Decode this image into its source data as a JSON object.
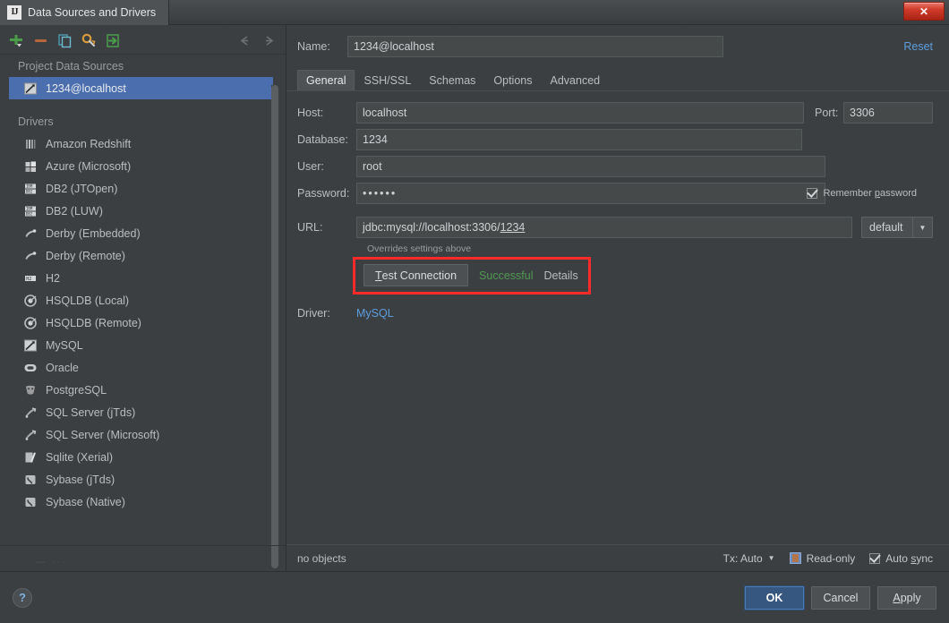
{
  "window": {
    "title": "Data Sources and Drivers",
    "app_icon": "IJ",
    "close_label": "✕"
  },
  "toolbar": {
    "items": [
      {
        "name": "add-icon",
        "label": "Add"
      },
      {
        "name": "remove-icon",
        "label": "Remove"
      },
      {
        "name": "copy-icon",
        "label": "Copy"
      },
      {
        "name": "properties-icon",
        "label": "Properties"
      },
      {
        "name": "import-icon",
        "label": "Import"
      }
    ],
    "nav": [
      {
        "name": "back-arrow-icon",
        "label": "⇦"
      },
      {
        "name": "forward-arrow-icon",
        "label": "⇨"
      }
    ]
  },
  "sidebar": {
    "project_group_label": "Project Data Sources",
    "data_sources": [
      {
        "label": "1234@localhost",
        "icon": "mysql-icon",
        "selected": true
      }
    ],
    "drivers_group_label": "Drivers",
    "drivers": [
      {
        "label": "Amazon Redshift",
        "icon": "redshift-icon"
      },
      {
        "label": "Azure (Microsoft)",
        "icon": "azure-icon"
      },
      {
        "label": "DB2 (JTOpen)",
        "icon": "db2-icon"
      },
      {
        "label": "DB2 (LUW)",
        "icon": "db2-icon"
      },
      {
        "label": "Derby (Embedded)",
        "icon": "derby-icon"
      },
      {
        "label": "Derby (Remote)",
        "icon": "derby-icon"
      },
      {
        "label": "H2",
        "icon": "h2-icon"
      },
      {
        "label": "HSQLDB (Local)",
        "icon": "hsqldb-icon"
      },
      {
        "label": "HSQLDB (Remote)",
        "icon": "hsqldb-icon"
      },
      {
        "label": "MySQL",
        "icon": "mysql-icon"
      },
      {
        "label": "Oracle",
        "icon": "oracle-icon"
      },
      {
        "label": "PostgreSQL",
        "icon": "postgresql-icon"
      },
      {
        "label": "SQL Server (jTds)",
        "icon": "sqlserver-icon"
      },
      {
        "label": "SQL Server (Microsoft)",
        "icon": "sqlserver-icon"
      },
      {
        "label": "Sqlite (Xerial)",
        "icon": "sqlite-icon"
      },
      {
        "label": "Sybase (jTds)",
        "icon": "sybase-icon"
      },
      {
        "label": "Sybase (Native)",
        "icon": "sybase-icon"
      }
    ]
  },
  "detail": {
    "name_label": "Name:",
    "name_value": "1234@localhost",
    "reset_label": "Reset",
    "tabs": [
      {
        "label": "General",
        "active": true
      },
      {
        "label": "SSH/SSL",
        "active": false
      },
      {
        "label": "Schemas",
        "active": false
      },
      {
        "label": "Options",
        "active": false
      },
      {
        "label": "Advanced",
        "active": false
      }
    ],
    "fields": {
      "host_label": "Host:",
      "host_value": "localhost",
      "port_label": "Port:",
      "port_value": "3306",
      "database_label": "Database:",
      "database_value": "1234",
      "user_label": "User:",
      "user_value": "root",
      "password_label": "Password:",
      "password_value": "••••••",
      "remember_password_label": "Remember password",
      "remember_password_checked": true,
      "url_label": "URL:",
      "url_value_prefix": "jdbc:mysql://localhost:3306/",
      "url_value_underlined": "1234",
      "url_combo_value": "default",
      "url_combo_arrow": "▼",
      "overrides_note": "Overrides settings above"
    },
    "test": {
      "button_mnemonic": "T",
      "button_label_rest": "est Connection",
      "status": "Successful",
      "details_label": "Details"
    },
    "driver_label": "Driver:",
    "driver_value": "MySQL"
  },
  "status_bar": {
    "objects_text": "no objects",
    "tx_label": "Tx: Auto",
    "tx_arrow": "▼",
    "read_only_label": "Read-only",
    "read_only_checked": false,
    "auto_sync_mnemonic_prefix": "Auto ",
    "auto_sync_mnemonic": "s",
    "auto_sync_suffix": "ync",
    "auto_sync_checked": true
  },
  "footer": {
    "help_label": "?",
    "ok_label": "OK",
    "cancel_label": "Cancel",
    "apply_mnemonic": "A",
    "apply_rest": "pply"
  },
  "colors": {
    "background": "#3c3f41",
    "selection": "#4b6eaf",
    "link": "#5c9ede",
    "success": "#4f9a52",
    "highlight_box": "#ff2b2b",
    "primary_button": "#365880",
    "close_button": "#cf3b29"
  }
}
